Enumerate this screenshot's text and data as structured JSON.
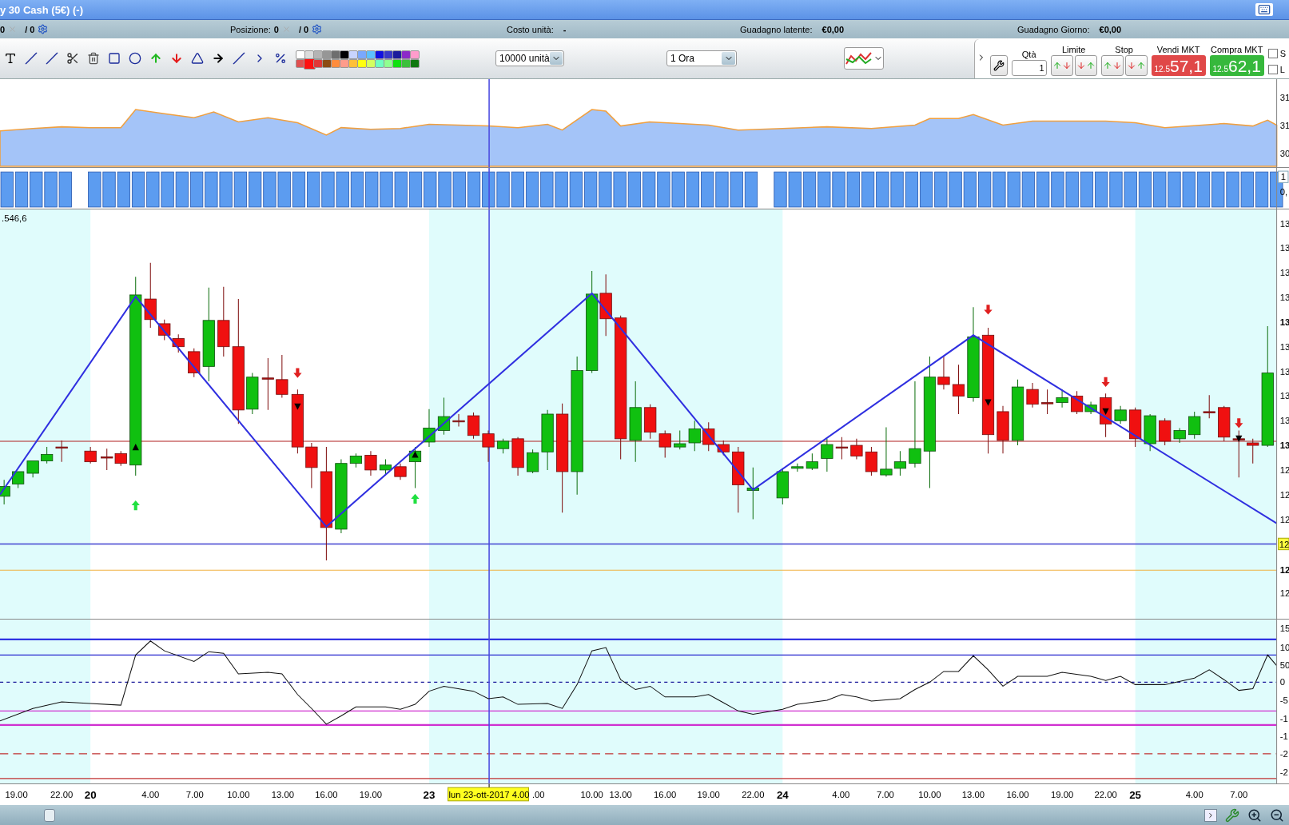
{
  "window": {
    "title": "y 30 Cash (5€) (-)"
  },
  "info_bar": {
    "items": [
      {
        "kind": "counter",
        "value": "0",
        "count": "/ 0"
      },
      {
        "kind": "counter",
        "label": "Posizione:",
        "value": "0",
        "count": "/ 0"
      },
      {
        "kind": "text",
        "label": "Costo unità:",
        "value": "-"
      },
      {
        "kind": "text",
        "label": "Guadagno latente:",
        "value": "€0,00"
      },
      {
        "kind": "text",
        "label": "Guadagno Giorno:",
        "value": "€0,00"
      }
    ]
  },
  "toolbar": {
    "palette": [
      {
        "color": "#ffffff",
        "selected": false
      },
      {
        "color": "#dcdcdc",
        "selected": false
      },
      {
        "color": "#b4b4b4",
        "selected": false
      },
      {
        "color": "#969696",
        "selected": false
      },
      {
        "color": "#6e6e6e",
        "selected": false
      },
      {
        "color": "#000000",
        "selected": false
      },
      {
        "color": "#c8d4ff",
        "selected": false
      },
      {
        "color": "#7aa8ff",
        "selected": false
      },
      {
        "color": "#5cc0ff",
        "selected": false
      },
      {
        "color": "#1010e0",
        "selected": false
      },
      {
        "color": "#3838c8",
        "selected": false
      },
      {
        "color": "#1c1c9c",
        "selected": false
      },
      {
        "color": "#8c28c8",
        "selected": false
      },
      {
        "color": "#ff9ccc",
        "selected": false
      },
      {
        "color": "#e05050",
        "selected": false
      },
      {
        "color": "#ff1010",
        "selected": true
      },
      {
        "color": "#e03838",
        "selected": false
      },
      {
        "color": "#8c4c14",
        "selected": false
      },
      {
        "color": "#ff8c3c",
        "selected": false
      },
      {
        "color": "#ff9c8c",
        "selected": false
      },
      {
        "color": "#ffc038",
        "selected": false
      },
      {
        "color": "#ffff10",
        "selected": false
      },
      {
        "color": "#d4ff60",
        "selected": false
      },
      {
        "color": "#70ffc0",
        "selected": false
      },
      {
        "color": "#90ff90",
        "selected": false
      },
      {
        "color": "#10e010",
        "selected": false
      },
      {
        "color": "#3cc03c",
        "selected": false
      },
      {
        "color": "#107810",
        "selected": false
      }
    ],
    "quantity_select": {
      "value": "10000 unità"
    },
    "timeframe_select": {
      "value": "1 Ora"
    }
  },
  "order_panel": {
    "quantity": {
      "label": "Qtà",
      "value": "1"
    },
    "limit": {
      "label": "Limite"
    },
    "stop": {
      "label": "Stop"
    },
    "sell": {
      "label": "Vendi MKT",
      "prefix": "12.5",
      "price": "57,1"
    },
    "buy": {
      "label": "Compra MKT",
      "prefix": "12.5",
      "price": "62,1"
    },
    "options": [
      {
        "label": "S",
        "checked": false
      },
      {
        "label": "L",
        "checked": false
      }
    ]
  },
  "charts": {
    "price_label": ".546,6",
    "area_axis": [
      "31",
      "31",
      "30"
    ],
    "volume_axis": [
      "1",
      "0,"
    ],
    "price_axis": [
      "13",
      "13",
      "13",
      "13",
      "13",
      "13",
      "13",
      "13",
      "13",
      "13",
      "12",
      "12",
      "12",
      "12",
      "12",
      "12"
    ],
    "oscillator_axis": [
      "15",
      "10",
      "50",
      "0",
      "-5",
      "-1",
      "-1",
      "-2",
      "-2"
    ],
    "x_axis": [
      {
        "label": "19.00",
        "kind": "hour"
      },
      {
        "label": "22.00",
        "kind": "hour"
      },
      {
        "label": "20",
        "kind": "day"
      },
      {
        "label": "4.00",
        "kind": "hour"
      },
      {
        "label": "7.00",
        "kind": "hour"
      },
      {
        "label": "10.00",
        "kind": "hour"
      },
      {
        "label": "13.00",
        "kind": "hour"
      },
      {
        "label": "16.00",
        "kind": "hour"
      },
      {
        "label": "19.00",
        "kind": "hour"
      },
      {
        "label": "23",
        "kind": "day"
      },
      {
        "label": "lun 23-ott-2017 4.00",
        "kind": "cursor"
      },
      {
        "label": ".00",
        "kind": "hour"
      },
      {
        "label": "10.00",
        "kind": "hour"
      },
      {
        "label": "13.00",
        "kind": "hour"
      },
      {
        "label": "16.00",
        "kind": "hour"
      },
      {
        "label": "19.00",
        "kind": "hour"
      },
      {
        "label": "22.00",
        "kind": "hour"
      },
      {
        "label": "24",
        "kind": "day"
      },
      {
        "label": "4.00",
        "kind": "hour"
      },
      {
        "label": "7.00",
        "kind": "hour"
      },
      {
        "label": "10.00",
        "kind": "hour"
      },
      {
        "label": "13.00",
        "kind": "hour"
      },
      {
        "label": "16.00",
        "kind": "hour"
      },
      {
        "label": "19.00",
        "kind": "hour"
      },
      {
        "label": "22.00",
        "kind": "hour"
      },
      {
        "label": "25",
        "kind": "day"
      },
      {
        "label": "4.00",
        "kind": "hour"
      },
      {
        "label": "7.00",
        "kind": "hour"
      }
    ]
  }
}
